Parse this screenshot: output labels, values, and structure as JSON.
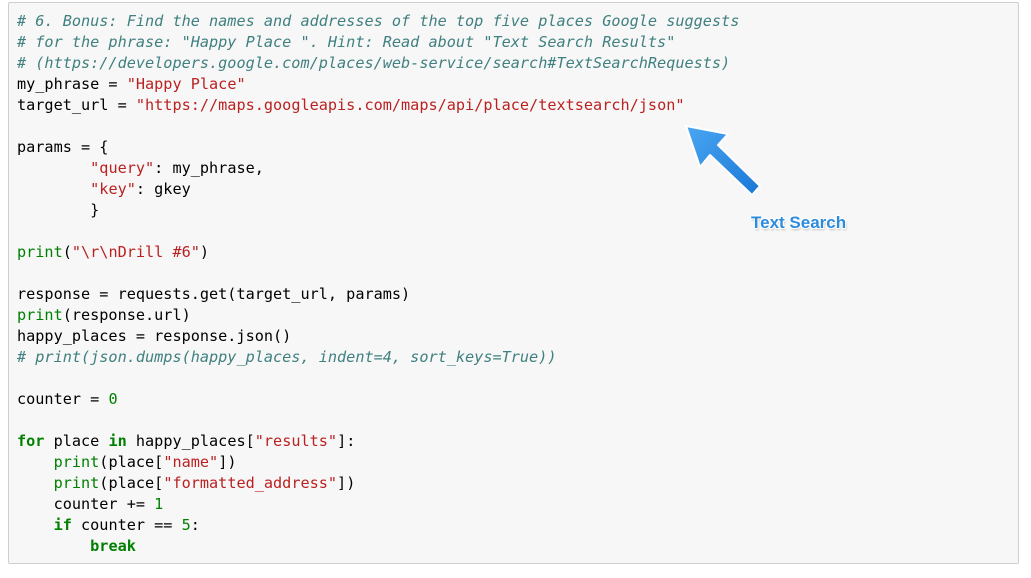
{
  "colors": {
    "cell_background": "#f7f7f7",
    "comment": "#408080",
    "string": "#ba2121",
    "number": "#008000",
    "keyword": "#008000",
    "annotation": "#2d8bdc"
  },
  "code": {
    "lines": [
      [
        {
          "t": "# 6. Bonus: Find the names and addresses of the top five places Google suggests",
          "k": "comment"
        }
      ],
      [
        {
          "t": "# for the phrase: \"Happy Place \". Hint: Read about \"Text Search Results\"",
          "k": "comment"
        }
      ],
      [
        {
          "t": "# (https://developers.google.com/places/web-service/search#TextSearchRequests)",
          "k": "comment"
        }
      ],
      [
        {
          "t": "my_phrase = ",
          "k": "plain"
        },
        {
          "t": "\"Happy Place\"",
          "k": "string"
        }
      ],
      [
        {
          "t": "target_url = ",
          "k": "plain"
        },
        {
          "t": "\"https://maps.googleapis.com/maps/api/place/textsearch/json\"",
          "k": "string"
        }
      ],
      [],
      [
        {
          "t": "params = {",
          "k": "plain"
        }
      ],
      [
        {
          "t": "        ",
          "k": "plain"
        },
        {
          "t": "\"query\"",
          "k": "string"
        },
        {
          "t": ": my_phrase,",
          "k": "plain"
        }
      ],
      [
        {
          "t": "        ",
          "k": "plain"
        },
        {
          "t": "\"key\"",
          "k": "string"
        },
        {
          "t": ": gkey",
          "k": "plain"
        }
      ],
      [
        {
          "t": "        }",
          "k": "plain"
        }
      ],
      [],
      [
        {
          "t": "print",
          "k": "builtin"
        },
        {
          "t": "(",
          "k": "plain"
        },
        {
          "t": "\"\\r\\nDrill #6\"",
          "k": "string"
        },
        {
          "t": ")",
          "k": "plain"
        }
      ],
      [],
      [
        {
          "t": "response = requests.get(target_url, params)",
          "k": "plain"
        }
      ],
      [
        {
          "t": "print",
          "k": "builtin"
        },
        {
          "t": "(response.url)",
          "k": "plain"
        }
      ],
      [
        {
          "t": "happy_places = response.json()",
          "k": "plain"
        }
      ],
      [
        {
          "t": "# print(json.dumps(happy_places, indent=4, sort_keys=True))",
          "k": "comment"
        }
      ],
      [],
      [
        {
          "t": "counter = ",
          "k": "plain"
        },
        {
          "t": "0",
          "k": "number"
        }
      ],
      [],
      [
        {
          "t": "for",
          "k": "keyword"
        },
        {
          "t": " place ",
          "k": "plain"
        },
        {
          "t": "in",
          "k": "keyword"
        },
        {
          "t": " happy_places[",
          "k": "plain"
        },
        {
          "t": "\"results\"",
          "k": "string"
        },
        {
          "t": "]:",
          "k": "plain"
        }
      ],
      [
        {
          "t": "    ",
          "k": "plain"
        },
        {
          "t": "print",
          "k": "builtin"
        },
        {
          "t": "(place[",
          "k": "plain"
        },
        {
          "t": "\"name\"",
          "k": "string"
        },
        {
          "t": "])",
          "k": "plain"
        }
      ],
      [
        {
          "t": "    ",
          "k": "plain"
        },
        {
          "t": "print",
          "k": "builtin"
        },
        {
          "t": "(place[",
          "k": "plain"
        },
        {
          "t": "\"formatted_address\"",
          "k": "string"
        },
        {
          "t": "])",
          "k": "plain"
        }
      ],
      [
        {
          "t": "    counter += ",
          "k": "plain"
        },
        {
          "t": "1",
          "k": "number"
        }
      ],
      [
        {
          "t": "    ",
          "k": "plain"
        },
        {
          "t": "if",
          "k": "keyword"
        },
        {
          "t": " counter == ",
          "k": "plain"
        },
        {
          "t": "5",
          "k": "number"
        },
        {
          "t": ":",
          "k": "plain"
        }
      ],
      [
        {
          "t": "        ",
          "k": "plain"
        },
        {
          "t": "break",
          "k": "keyword"
        }
      ]
    ]
  },
  "annotation": {
    "label": "Text Search",
    "icon": "arrow-icon"
  }
}
